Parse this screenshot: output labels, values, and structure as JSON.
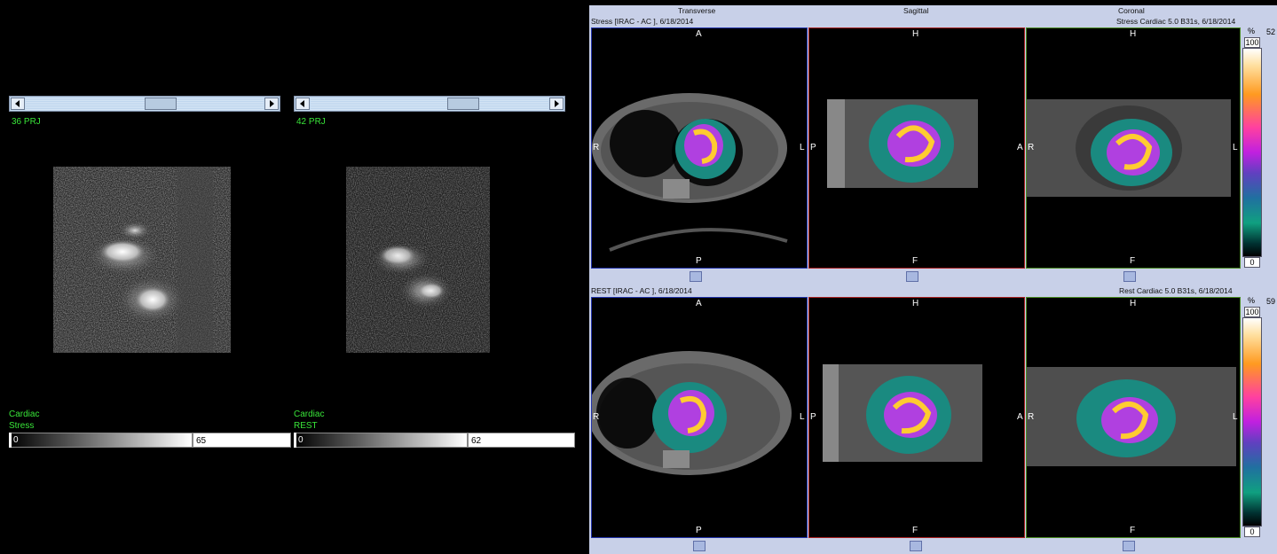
{
  "left_panels": [
    {
      "projection_label": "36 PRJ",
      "slider_fraction": 0.58,
      "title_line1": "Cardiac",
      "title_line2": "Stress",
      "scale_min": "0",
      "scale_max": "65"
    },
    {
      "projection_label": "42 PRJ",
      "slider_fraction": 0.77,
      "title_line1": "Cardiac",
      "title_line2": "REST",
      "scale_min": "0",
      "scale_max": "62"
    }
  ],
  "right_panel": {
    "column_headers": [
      "Transverse",
      "Sagittal",
      "Coronal"
    ],
    "rows": [
      {
        "left_caption": "Stress [IRAC - AC ], 6/18/2014",
        "right_caption": "Stress Cardiac  5.0  B31s, 6/18/2014",
        "colorbar_unit": "%",
        "colorbar_top": "100",
        "colorbar_bottom": "0",
        "side_value": "52"
      },
      {
        "left_caption": "REST [IRAC - AC ], 6/18/2014",
        "right_caption": "Rest Cardiac  5.0  B31s, 6/18/2014",
        "colorbar_unit": "%",
        "colorbar_top": "100",
        "colorbar_bottom": "0",
        "side_value": "59"
      }
    ],
    "orientation": {
      "transverse": {
        "top": "A",
        "bottom": "P",
        "left": "R",
        "right": "L"
      },
      "sagittal": {
        "top": "H",
        "bottom": "F",
        "left": "P",
        "right": "A"
      },
      "coronal": {
        "top": "H",
        "bottom": "F",
        "left": "R",
        "right": "L"
      }
    }
  },
  "colors": {
    "overlay_green": "#39e639",
    "panel_bg": "#c8d0e8",
    "transverse_border": "#2233aa",
    "sagittal_border": "#aa2222",
    "coronal_border": "#4a8a22"
  }
}
